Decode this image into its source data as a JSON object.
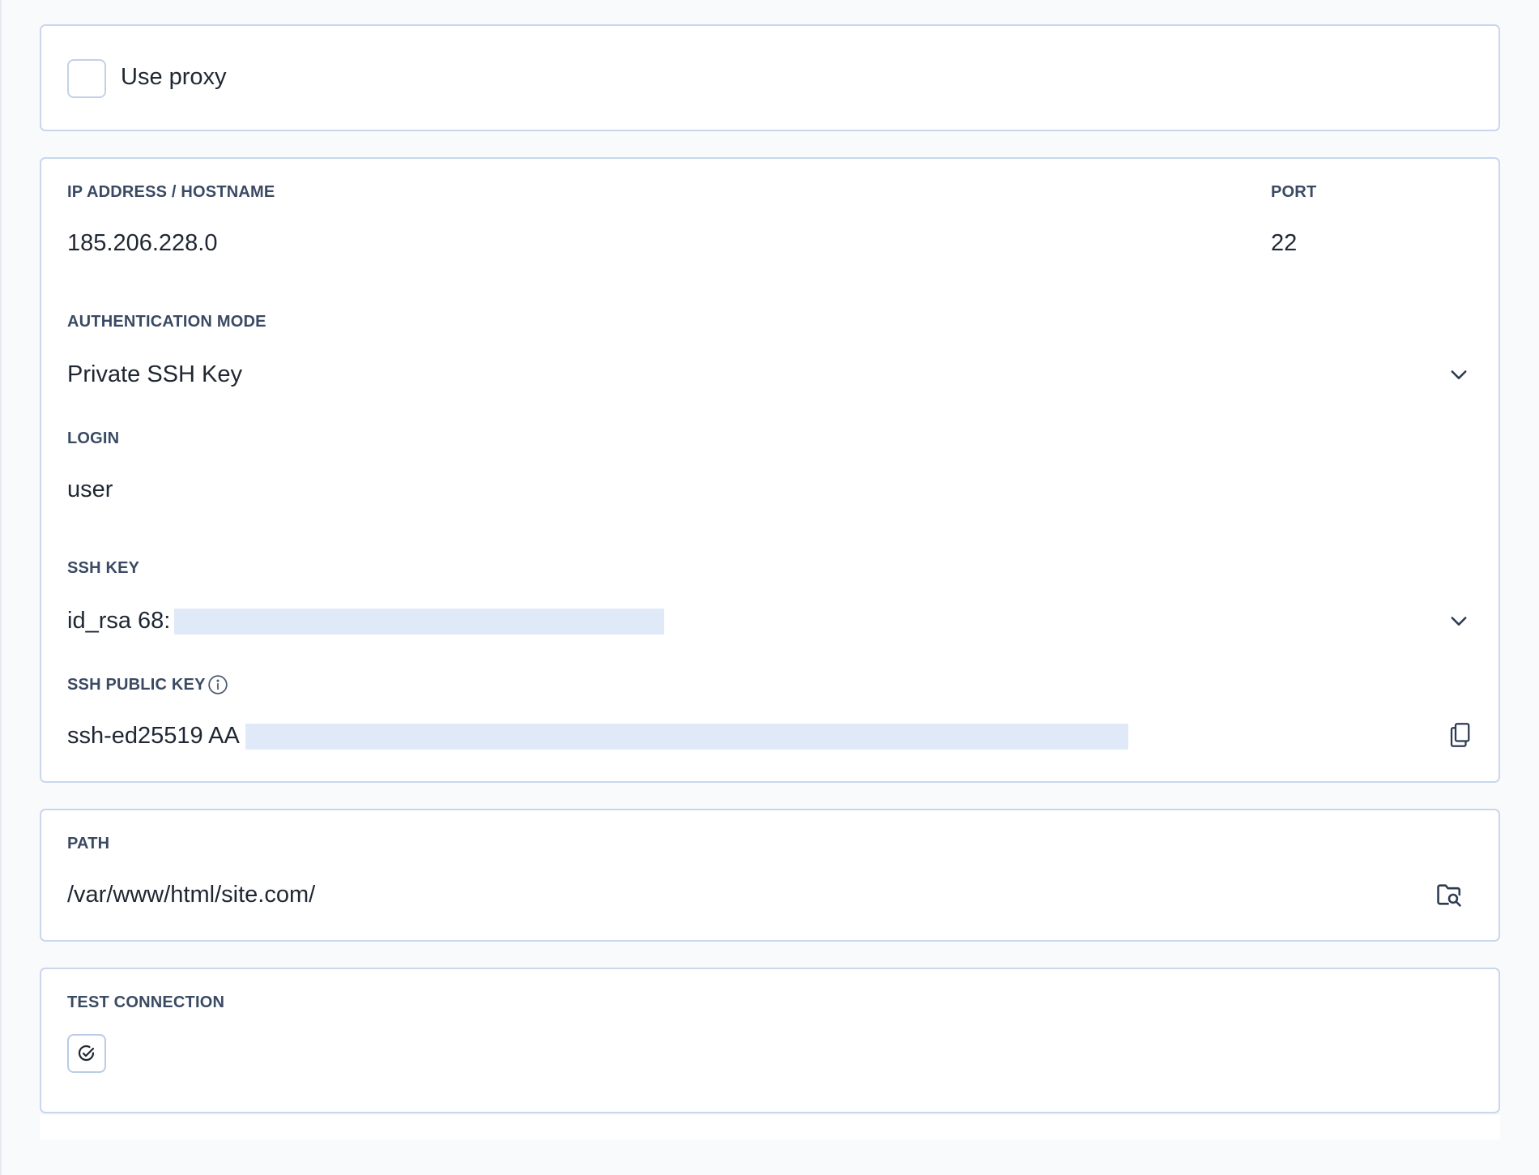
{
  "proxy": {
    "label": "Use proxy",
    "checked": false
  },
  "connection": {
    "host_label": "IP ADDRESS / HOSTNAME",
    "host_value": "185.206.228.0",
    "port_label": "PORT",
    "port_value": "22",
    "auth_label": "AUTHENTICATION MODE",
    "auth_value": "Private SSH Key",
    "login_label": "LOGIN",
    "login_value": "user",
    "ssh_key_label": "SSH KEY",
    "ssh_key_value": "id_rsa 68:",
    "ssh_public_key_label": "SSH PUBLIC KEY",
    "ssh_public_key_value": "ssh-ed25519 AA"
  },
  "path": {
    "label": "PATH",
    "value": "/var/www/html/site.com/"
  },
  "test": {
    "label": "TEST CONNECTION"
  },
  "icons": {
    "auth_dropdown": "chevron-down-icon",
    "ssh_key_dropdown": "chevron-down-icon",
    "info": "info-icon",
    "copy": "copy-icon",
    "browse": "folder-search-icon",
    "test": "check-circle-icon"
  },
  "colors": {
    "card_border": "#c8d7ee",
    "label": "#3a4a63",
    "text": "#1f2733",
    "redaction": "#e0e9f8",
    "background": "#f9fafc"
  }
}
